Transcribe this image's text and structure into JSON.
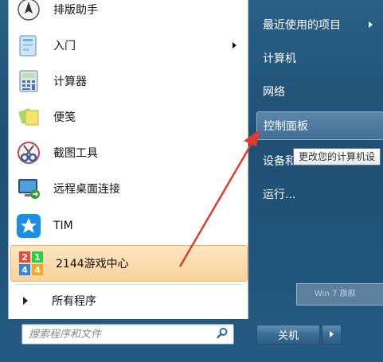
{
  "programs": [
    {
      "label": "排版助手",
      "icon": "typesetting-pen-icon"
    },
    {
      "label": "入门",
      "icon": "getting-started-icon",
      "has_submenu": true
    },
    {
      "label": "计算器",
      "icon": "calculator-icon"
    },
    {
      "label": "便笺",
      "icon": "sticky-notes-icon"
    },
    {
      "label": "截图工具",
      "icon": "snipping-tool-icon"
    },
    {
      "label": "远程桌面连接",
      "icon": "remote-desktop-icon"
    },
    {
      "label": "TIM",
      "icon": "tim-star-icon"
    },
    {
      "label": "2144游戏中心",
      "icon": "game-center-2144-icon",
      "highlighted": true
    }
  ],
  "all_programs_label": "所有程序",
  "search": {
    "placeholder": "搜索程序和文件"
  },
  "right_links": [
    {
      "label": "最近使用的项目",
      "has_submenu": true
    },
    {
      "label": "计算机"
    },
    {
      "label": "网络"
    },
    {
      "label": "控制面板",
      "selected": true
    },
    {
      "label": "设备和打印机"
    },
    {
      "label": "运行..."
    }
  ],
  "tooltip": "更改您的计算机设",
  "shutdown_label": "关机",
  "ghost_text": "Win 7   旗舰",
  "colors": {
    "highlight": "#f9d29a",
    "panel_blue": "#245a82",
    "annotation_red": "#e23b2e"
  }
}
